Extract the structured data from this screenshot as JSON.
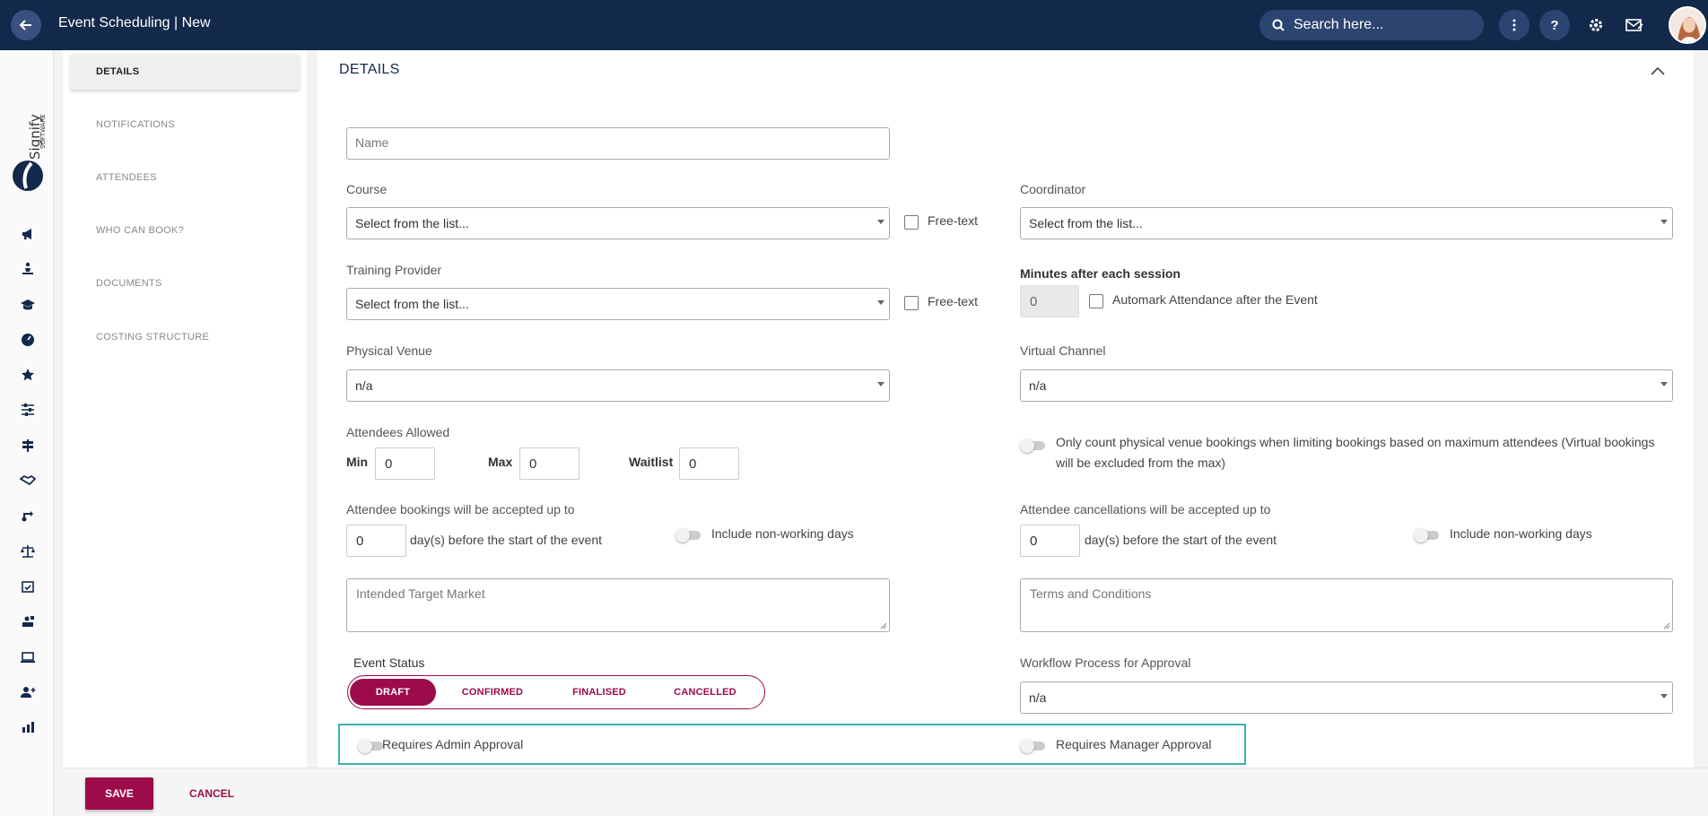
{
  "header": {
    "title": "Event Scheduling | New",
    "search_placeholder": "Search here...",
    "help_label": "?"
  },
  "rail": {
    "logo_text": "Signify",
    "logo_subtext": "SOFTWARE"
  },
  "sections": [
    {
      "label": "DETAILS",
      "active": true
    },
    {
      "label": "NOTIFICATIONS",
      "active": false
    },
    {
      "label": "ATTENDEES",
      "active": false
    },
    {
      "label": "WHO CAN BOOK?",
      "active": false
    },
    {
      "label": "DOCUMENTS",
      "active": false
    },
    {
      "label": "COSTING STRUCTURE",
      "active": false
    }
  ],
  "details": {
    "title": "DETAILS",
    "name_placeholder": "Name",
    "course": {
      "label": "Course",
      "value": "Select from the list...",
      "freetext_label": "Free-text"
    },
    "coordinator": {
      "label": "Coordinator",
      "value": "Select from the list..."
    },
    "training_provider": {
      "label": "Training Provider",
      "value": "Select from the list...",
      "freetext_label": "Free-text"
    },
    "minutes_after": {
      "label": "Minutes after each session",
      "value": "0",
      "automark_label": "Automark Attendance after the Event"
    },
    "physical_venue": {
      "label": "Physical Venue",
      "value": "n/a"
    },
    "virtual_channel": {
      "label": "Virtual Channel",
      "value": "n/a"
    },
    "attendees": {
      "label": "Attendees Allowed",
      "min_label": "Min",
      "min_value": "0",
      "max_label": "Max",
      "max_value": "0",
      "waitlist_label": "Waitlist",
      "waitlist_value": "0"
    },
    "only_count_line1": "Only count physical venue bookings when limiting bookings based on maximum attendees (Virtual bookings",
    "only_count_line2": "will be excluded from the max)",
    "bookings": {
      "label": "Attendee bookings will be accepted up to",
      "value": "0",
      "suffix": "day(s) before the start of the event",
      "nonworking_label": "Include non-working days"
    },
    "cancellations": {
      "label": "Attendee cancellations will be accepted up to",
      "value": "0",
      "suffix": "day(s) before the start of the event",
      "nonworking_label": "Include non-working days"
    },
    "target_market_placeholder": "Intended Target Market",
    "terms_placeholder": "Terms and Conditions",
    "event_status": {
      "label": "Event Status",
      "options": [
        "DRAFT",
        "CONFIRMED",
        "FINALISED",
        "CANCELLED"
      ],
      "selected": "DRAFT"
    },
    "workflow": {
      "label": "Workflow Process for Approval",
      "value": "n/a"
    },
    "admin_approval_label": "Requires Admin Approval",
    "manager_approval_label": "Requires Manager Approval"
  },
  "footer": {
    "save_label": "SAVE",
    "cancel_label": "CANCEL"
  },
  "colors": {
    "header_bg": "#13294b",
    "accent": "#9c0c4b",
    "highlight_border": "#3bb3ad"
  }
}
